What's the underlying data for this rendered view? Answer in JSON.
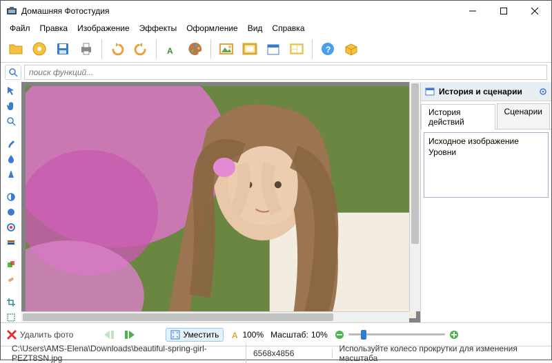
{
  "window": {
    "title": "Домашняя Фотостудия"
  },
  "menu": {
    "file": "Файл",
    "edit": "Правка",
    "image": "Изображение",
    "effects": "Эффекты",
    "design": "Оформление",
    "view": "Вид",
    "help": "Справка"
  },
  "search": {
    "placeholder": "поиск функций..."
  },
  "right_panel": {
    "title": "История и сценарии",
    "tab_history": "История действий",
    "tab_scripts": "Сценарии",
    "history_items": {
      "i0": "Исходное изображение",
      "i1": "Уровни"
    }
  },
  "bottom": {
    "delete": "Удалить фото",
    "fit": "Уместить",
    "percent": "100%",
    "zoom_label": "Масштаб:",
    "zoom_value": "10%"
  },
  "status": {
    "path": "C:\\Users\\AMS-Elena\\Downloads\\beautiful-spring-girl-PEZT8SN.jpg",
    "dims": "6568x4856",
    "hint": "Используйте колесо прокрутки для изменения масштаба"
  }
}
